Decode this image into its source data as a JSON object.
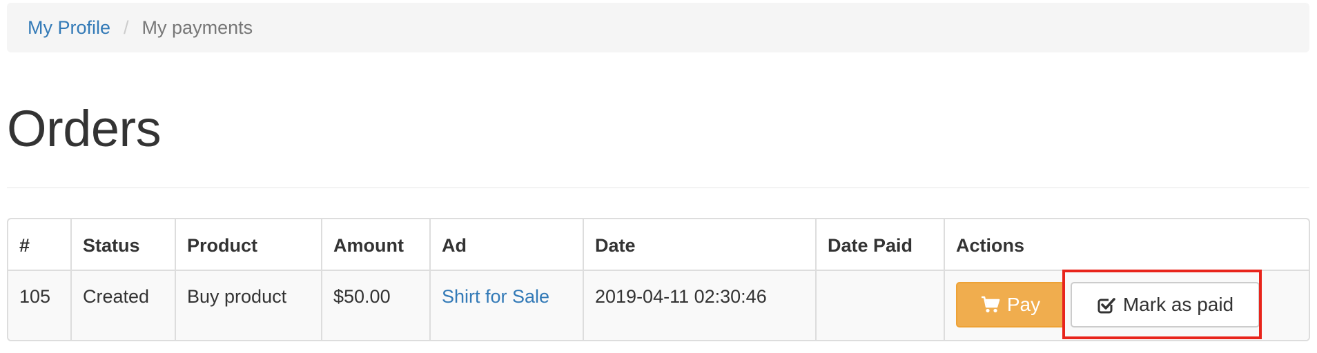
{
  "breadcrumb": {
    "items": [
      {
        "label": "My Profile",
        "link": true
      },
      {
        "label": "My payments",
        "link": false
      }
    ],
    "separator": "/"
  },
  "page": {
    "title": "Orders"
  },
  "orders_table": {
    "columns": [
      "#",
      "Status",
      "Product",
      "Amount",
      "Ad",
      "Date",
      "Date Paid",
      "Actions"
    ],
    "rows": [
      {
        "id": "105",
        "status": "Created",
        "product": "Buy product",
        "amount": "$50.00",
        "ad": "Shirt for Sale",
        "date": "2019-04-11 02:30:46",
        "date_paid": "",
        "actions": {
          "pay_label": "Pay",
          "pay_icon": "shopping-cart-icon",
          "mark_paid_label": "Mark as paid",
          "mark_paid_icon": "check-square-icon"
        }
      }
    ]
  },
  "colors": {
    "link": "#337ab7",
    "pay_button": "#f0ad4e",
    "highlight": "#e8241b"
  }
}
